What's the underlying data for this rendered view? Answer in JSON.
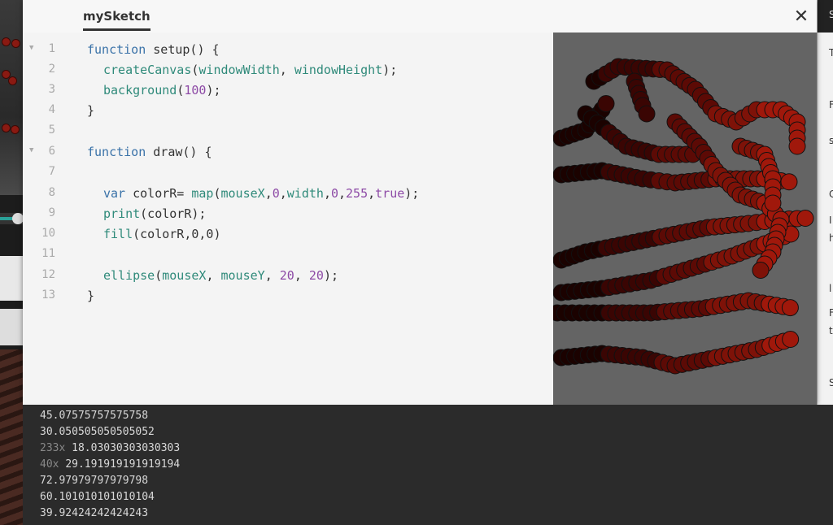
{
  "window": {
    "tab_title": "mySketch",
    "close_label": "✕"
  },
  "editor": {
    "lines": [
      {
        "n": "1",
        "fold": true
      },
      {
        "n": "2",
        "fold": false
      },
      {
        "n": "3",
        "fold": false
      },
      {
        "n": "4",
        "fold": false
      },
      {
        "n": "5",
        "fold": false
      },
      {
        "n": "6",
        "fold": true
      },
      {
        "n": "7",
        "fold": false
      },
      {
        "n": "8",
        "fold": false
      },
      {
        "n": "9",
        "fold": false
      },
      {
        "n": "10",
        "fold": false
      },
      {
        "n": "11",
        "fold": false
      },
      {
        "n": "12",
        "fold": false
      },
      {
        "n": "13",
        "fold": false
      }
    ],
    "code": {
      "l1": {
        "kw": "function",
        "rest": " setup() {"
      },
      "l2": {
        "fn": "createCanvas",
        "p1": "(",
        "a1": "windowWidth",
        "c1": ", ",
        "a2": "windowHeight",
        "end": ");"
      },
      "l3": {
        "fn": "background",
        "p1": "(",
        "n1": "100",
        "end": ");"
      },
      "l4": {
        "text": "}"
      },
      "l6": {
        "kw": "function",
        "rest": " draw() {"
      },
      "l8": {
        "kw": "var",
        "t1": " colorR= ",
        "fn": "map",
        "p1": "(",
        "a1": "mouseX",
        "c1": ",",
        "n1": "0",
        "c2": ",",
        "a2": "width",
        "c3": ",",
        "n2": "0",
        "c4": ",",
        "n3": "255",
        "c5": ",",
        "n4": "true",
        "end": ");"
      },
      "l9": {
        "fn": "print",
        "rest": "(colorR);"
      },
      "l10": {
        "fn": "fill",
        "rest": "(colorR,0,0)"
      },
      "l12": {
        "fn": "ellipse",
        "p1": "(",
        "a1": "mouseX",
        "c1": ", ",
        "a2": "mouseY",
        "c2": ", ",
        "n1": "20",
        "c3": ", ",
        "n2": "20",
        "end": ");"
      },
      "l13": {
        "text": "}"
      }
    }
  },
  "console": {
    "lines": [
      {
        "count": "",
        "value": "45.07575757575758"
      },
      {
        "count": "",
        "value": "30.050505050505052"
      },
      {
        "count": "233x",
        "value": "18.03030303030303"
      },
      {
        "count": "40x",
        "value": "29.191919191919194"
      },
      {
        "count": "",
        "value": "72.97979797979798"
      },
      {
        "count": "",
        "value": "60.101010101010104"
      },
      {
        "count": "",
        "value": "39.92424242424243"
      }
    ]
  },
  "canvas": {
    "background": "#646464",
    "stroke": "#111111",
    "colors": [
      "#1b0200",
      "#3a0503",
      "#5c0a05",
      "#7e1208",
      "#a0180b"
    ]
  },
  "right_panel": {
    "letters": [
      "S",
      "T",
      "F",
      "s",
      "C",
      "I",
      "h",
      "l",
      "F",
      "t",
      "S"
    ]
  }
}
